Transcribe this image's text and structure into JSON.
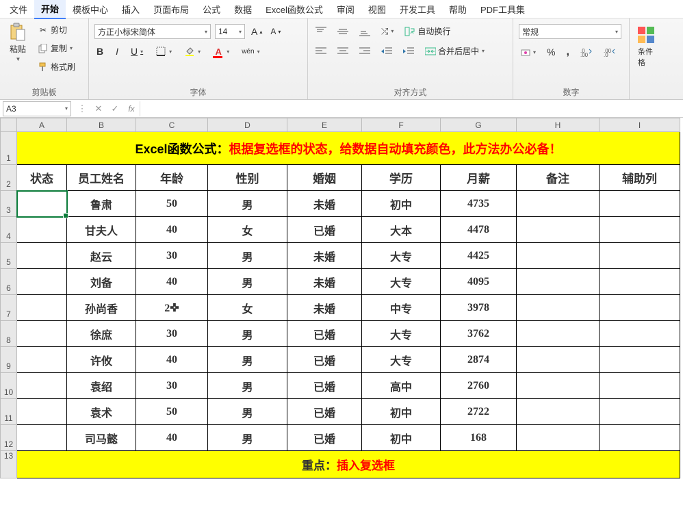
{
  "menu": {
    "items": [
      "文件",
      "开始",
      "模板中心",
      "插入",
      "页面布局",
      "公式",
      "数据",
      "Excel函数公式",
      "审阅",
      "视图",
      "开发工具",
      "帮助",
      "PDF工具集"
    ],
    "active": 1
  },
  "ribbon": {
    "clipboard": {
      "label": "剪贴板",
      "paste": "粘贴",
      "cut": "剪切",
      "copy": "复制",
      "format": "格式刷"
    },
    "font": {
      "label": "字体",
      "family": "方正小标宋简体",
      "size": "14",
      "bold": "B",
      "italic": "I",
      "underline": "U",
      "wen": "wén"
    },
    "align": {
      "label": "对齐方式",
      "wrap": "自动换行",
      "merge": "合并后居中"
    },
    "number": {
      "label": "数字",
      "format": "常规"
    },
    "cond": {
      "label": "条件格"
    }
  },
  "namebox": "A3",
  "columns": [
    "A",
    "B",
    "C",
    "D",
    "E",
    "F",
    "G",
    "H",
    "I"
  ],
  "title": {
    "black": "Excel函数公式：",
    "red": "根据复选框的状态，给数据自动填充颜色，此方法办公必备！"
  },
  "headers": [
    "状态",
    "员工姓名",
    "年龄",
    "性别",
    "婚姻",
    "学历",
    "月薪",
    "备注",
    "辅助列"
  ],
  "rows": [
    {
      "n": "3",
      "name": "鲁肃",
      "age": "50",
      "sex": "男",
      "mar": "未婚",
      "edu": "初中",
      "sal": "4735"
    },
    {
      "n": "4",
      "name": "甘夫人",
      "age": "40",
      "sex": "女",
      "mar": "已婚",
      "edu": "大本",
      "sal": "4478"
    },
    {
      "n": "5",
      "name": "赵云",
      "age": "30",
      "sex": "男",
      "mar": "未婚",
      "edu": "大专",
      "sal": "4425"
    },
    {
      "n": "6",
      "name": "刘备",
      "age": "40",
      "sex": "男",
      "mar": "未婚",
      "edu": "大专",
      "sal": "4095"
    },
    {
      "n": "7",
      "name": "孙尚香",
      "age": "2✜",
      "sex": "女",
      "mar": "未婚",
      "edu": "中专",
      "sal": "3978"
    },
    {
      "n": "8",
      "name": "徐庶",
      "age": "30",
      "sex": "男",
      "mar": "已婚",
      "edu": "大专",
      "sal": "3762"
    },
    {
      "n": "9",
      "name": "许攸",
      "age": "40",
      "sex": "男",
      "mar": "已婚",
      "edu": "大专",
      "sal": "2874"
    },
    {
      "n": "10",
      "name": "袁绍",
      "age": "30",
      "sex": "男",
      "mar": "已婚",
      "edu": "高中",
      "sal": "2760"
    },
    {
      "n": "11",
      "name": "袁术",
      "age": "50",
      "sex": "男",
      "mar": "已婚",
      "edu": "初中",
      "sal": "2722"
    },
    {
      "n": "12",
      "name": "司马懿",
      "age": "40",
      "sex": "男",
      "mar": "已婚",
      "edu": "初中",
      "sal": "168"
    }
  ],
  "footer": {
    "black": "重点：",
    "red": "插入复选框"
  },
  "chart_data": {
    "type": "table",
    "headers": [
      "员工姓名",
      "年龄",
      "性别",
      "婚姻",
      "学历",
      "月薪"
    ],
    "rows": [
      [
        "鲁肃",
        50,
        "男",
        "未婚",
        "初中",
        4735
      ],
      [
        "甘夫人",
        40,
        "女",
        "已婚",
        "大本",
        4478
      ],
      [
        "赵云",
        30,
        "男",
        "未婚",
        "大专",
        4425
      ],
      [
        "刘备",
        40,
        "男",
        "未婚",
        "大专",
        4095
      ],
      [
        "孙尚香",
        20,
        "女",
        "未婚",
        "中专",
        3978
      ],
      [
        "徐庶",
        30,
        "男",
        "已婚",
        "大专",
        3762
      ],
      [
        "许攸",
        40,
        "男",
        "已婚",
        "大专",
        2874
      ],
      [
        "袁绍",
        30,
        "男",
        "已婚",
        "高中",
        2760
      ],
      [
        "袁术",
        50,
        "男",
        "已婚",
        "初中",
        2722
      ],
      [
        "司马懿",
        40,
        "男",
        "已婚",
        "初中",
        168
      ]
    ]
  }
}
